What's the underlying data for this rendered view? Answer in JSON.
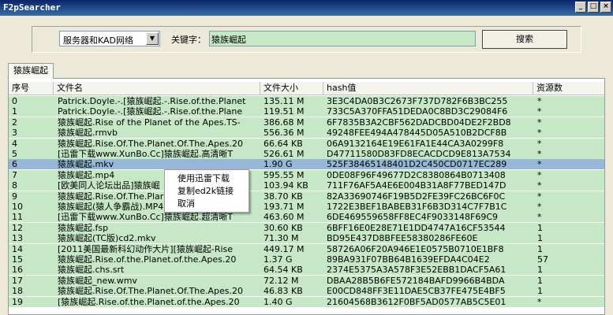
{
  "window": {
    "title": "F2pSearcher"
  },
  "search": {
    "category": "服务器和KAD网络",
    "keyword_label": "关键字：",
    "keyword_value": "猿族崛起",
    "button_label": "搜索"
  },
  "tab": {
    "label": "猿族崛起"
  },
  "columns": [
    "序号",
    "文件名",
    "文件大小",
    "hash值",
    "资源数"
  ],
  "rows": [
    {
      "idx": "0",
      "name": "Patrick.Doyle.-.[猿族崛起.-.Rise.of.the.Planet",
      "size": "135.11 M",
      "hash": "3E3C4DA0B3C2673F737D782F6B3BC255",
      "count": "*"
    },
    {
      "idx": "1",
      "name": "Patrick.Doyle.-.[猿族崛起.-.Rise.of.the.Plane",
      "size": "119.51 M",
      "hash": "733C5A370FFA51DEDA0C8BD3C29084F6",
      "count": "*"
    },
    {
      "idx": "2",
      "name": "猿族崛起.Rise of the Planet of the Apes.TS-",
      "size": "386.68 M",
      "hash": "6F7835B3A2CBF562DADCBD04DE2F2BD8",
      "count": "*"
    },
    {
      "idx": "3",
      "name": "猿族崛起.rmvb",
      "size": "556.36 M",
      "hash": "49248FEE494A478445D05A510B2DCF8B",
      "count": "*"
    },
    {
      "idx": "4",
      "name": "猿族崛起.Rise.Of.The.Planet.Of.The.Apes.20",
      "size": "66.64 KB",
      "hash": "06A9132164E19E61FA1E44CA3A0299F8",
      "count": "*"
    },
    {
      "idx": "5",
      "name": "[迅雷下载www.XunBo.Cc]猿族崛起.高清晰T",
      "size": "526.61 M",
      "hash": "D47711580D83FD8ECACDCD9E813A7534",
      "count": "*"
    },
    {
      "idx": "6",
      "name": "猿族崛起.mkv",
      "size": "1.90 G",
      "hash": "525F38465148401D2C450CD0717EC289",
      "count": "*"
    },
    {
      "idx": "7",
      "name": "猿族崛起.mp4",
      "size": "595.55 M",
      "hash": "0DE08F96F49677D2C8380864B0713408",
      "count": "*"
    },
    {
      "idx": "8",
      "name": "[欧美同人论坛出品]猿族崛",
      "size": "103.94 KB",
      "hash": "711F76AF5A4E6E004B31A8F77BED147D",
      "count": "*"
    },
    {
      "idx": "9",
      "name": "猿族崛起.Rise.Of.The.Plar",
      "size": "38.70 KB",
      "hash": "82A33690746F19B5D2FE39FC26BC6F0C",
      "count": "*"
    },
    {
      "idx": "10",
      "name": "猿族崛起(猿人争霸战).MP4",
      "size": "193.71 M",
      "hash": "1722E3BEF1BABEB31F6B3D314C7F7B1C",
      "count": "*"
    },
    {
      "idx": "11",
      "name": "[迅雷下载www.XunBo.Cc]猿族崛起.超清晰T",
      "size": "463.60 M",
      "hash": "6DE469559658FF8EC4F9033148F69C9",
      "count": "*"
    },
    {
      "idx": "12",
      "name": "猿族崛起.fsp",
      "size": "30.60 KB",
      "hash": "6BFF16E0E28E71E1DD4747A16CF53544",
      "count": "1"
    },
    {
      "idx": "13",
      "name": "猿族崛起(TC版)cd2.mkv",
      "size": "71.30 M",
      "hash": "BD95E437D8BFEE58380286FE60E",
      "count": "1"
    },
    {
      "idx": "14",
      "name": "[2011美国最新科幻动作大片][猿族崛起-Rise",
      "size": "449.17 M",
      "hash": "58726A06F20A946E1E0575B0710E1BF8",
      "count": "1"
    },
    {
      "idx": "15",
      "name": "猿族崛起.Rise.of.the.Planet.of.the.Apes.20",
      "size": "1.37 G",
      "hash": "89BA931F07BB64B1639EFDA4C04E2",
      "count": "57"
    },
    {
      "idx": "16",
      "name": "猿族崛起.chs.srt",
      "size": "64.54 KB",
      "hash": "2374E5375A3A578F3E52EBB1DACF5A61",
      "count": "1"
    },
    {
      "idx": "17",
      "name": "猿族崛起_new.wmv",
      "size": "72.12 M",
      "hash": "DBAA28B5B6FE572184BAFD9966B4BDA",
      "count": "1"
    },
    {
      "idx": "18",
      "name": "猿族崛起.Rise.Of.The.Planet.Of.The.Apes.20",
      "size": "46.83 KB",
      "hash": "E00CD848FF3E11DAE5CB37FE475E4BF5",
      "count": "1"
    },
    {
      "idx": "19",
      "name": "[猿族崛起.Rise.of.the.Planet.of.the.Apes.20",
      "size": "1.40 G",
      "hash": "21604568B3612F0BF5AD0577AB5C5E01",
      "count": "*"
    }
  ],
  "context_menu": [
    "使用迅雷下载",
    "复制ed2k链接",
    "取消"
  ]
}
